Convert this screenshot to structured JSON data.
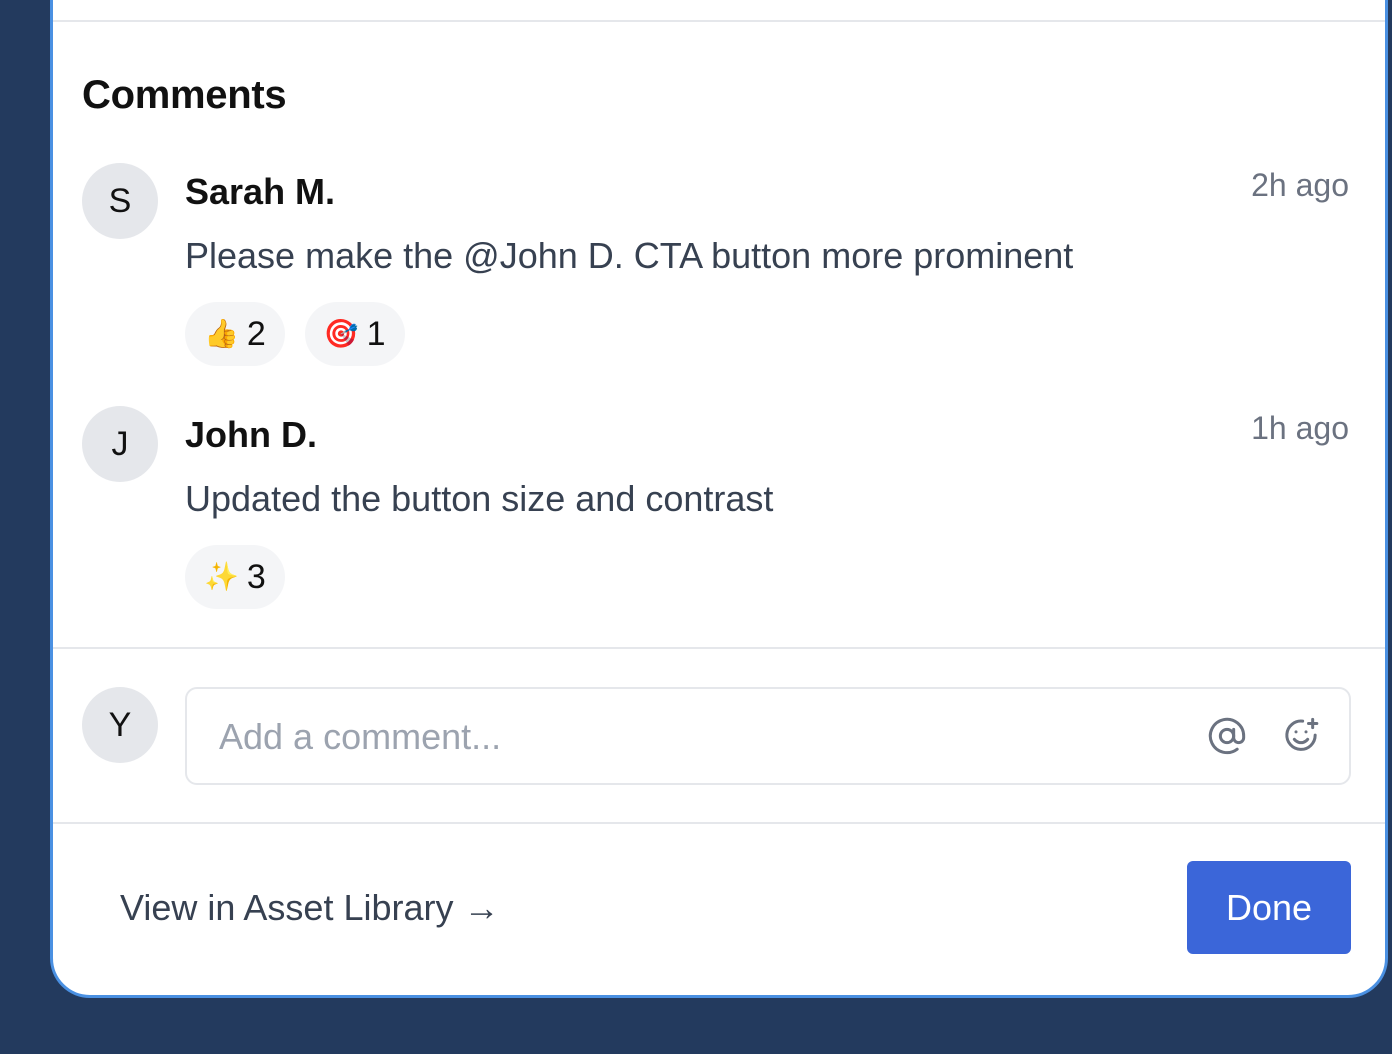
{
  "comments_section": {
    "title": "Comments",
    "items": [
      {
        "avatar_initial": "S",
        "author": "Sarah M.",
        "time": "2h ago",
        "text": "Please make the @John D. CTA button more prominent",
        "reactions": [
          {
            "emoji": "👍",
            "icon": "thumbs-up-icon",
            "count": "2"
          },
          {
            "emoji": "🎯",
            "icon": "target-icon",
            "count": "1"
          }
        ]
      },
      {
        "avatar_initial": "J",
        "author": "John D.",
        "time": "1h ago",
        "text": "Updated the button size and contrast",
        "reactions": [
          {
            "emoji": "✨",
            "icon": "sparkles-icon",
            "count": "3"
          }
        ]
      }
    ]
  },
  "composer": {
    "avatar_initial": "Y",
    "placeholder": "Add a comment...",
    "value": "",
    "mention_icon": "at-icon",
    "emoji_icon": "add-emoji-icon"
  },
  "footer": {
    "library_link": "View in Asset Library →",
    "done_label": "Done"
  },
  "colors": {
    "page_background": "#233a5e",
    "panel_border": "#4a90e2",
    "primary_button": "#3b66d9",
    "divider": "#e5e7eb"
  }
}
